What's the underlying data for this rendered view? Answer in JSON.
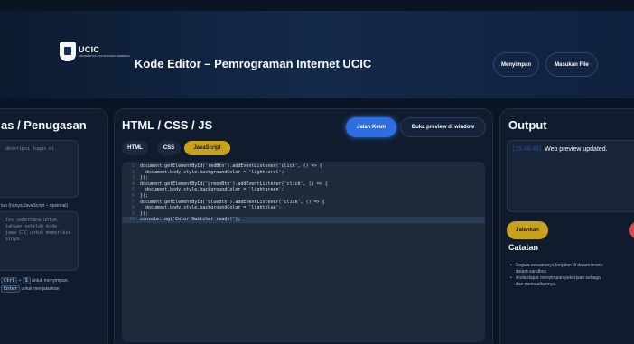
{
  "header": {
    "logo_main": "UCIC",
    "logo_sub": "UNIVERSITAS CATUR INSAN CENDEKIA",
    "title": "Kode Editor – Pemrograman Internet UCIC",
    "save_label": "Menyimpan",
    "load_label": "Masukan File"
  },
  "left_panel": {
    "title": "as / Penugasan",
    "desc_placeholder": "deskripsi tugas di",
    "js_label": "tuo (hanya JavaScript – opsional)",
    "js_text": "Tes sederhana untuk\ntahkan setelah kode\njawa CIC untuk memeriksa\nsinya.",
    "hint_key1": "Ctrl",
    "hint_plus": "+",
    "hint_key2": "S",
    "hint_text1": "untuk menyimpan,",
    "hint_key3": "Enter",
    "hint_text2": "untuk menjalankan"
  },
  "editor": {
    "title": "HTML / CSS / JS",
    "run_label": "Jalan Keun",
    "preview_label": "Buka preview di window",
    "tabs": [
      "HTML",
      "CSS",
      "JavaScript"
    ],
    "active_tab": "JavaScript",
    "lines": [
      {
        "n": "1",
        "code": "document.getElementById('redBtn').addEventListener('click', () => {"
      },
      {
        "n": "2",
        "code": "  document.body.style.backgroundColor = 'lightcoral';"
      },
      {
        "n": "3",
        "code": "});"
      },
      {
        "n": "4",
        "code": "document.getElementById('greenBtn').addEventListener('click', () => {"
      },
      {
        "n": "5",
        "code": "  document.body.style.backgroundColor = 'lightgreen';"
      },
      {
        "n": "6",
        "code": "});"
      },
      {
        "n": "7",
        "code": "document.getElementById('blueBtn').addEventListener('click', () => {"
      },
      {
        "n": "8",
        "code": "  document.body.style.backgroundColor = 'lightblue';"
      },
      {
        "n": "9",
        "code": "});"
      },
      {
        "n": "10",
        "code": "console.log('Color Switcher ready!');"
      }
    ]
  },
  "output": {
    "title": "Output",
    "timestamp": "[15:48:49]",
    "message": "Web preview updated.",
    "run_label": "Jalankan",
    "notes_title": "Catatan",
    "notes": [
      "Segala sesuatunya berjalan di dalam brows\ndalam sandbox.",
      "Anda dapat menyimpan pekerjaan sebaga\ndan memuatkannya."
    ]
  },
  "colors": {
    "accent_blue": "#2e6fe0",
    "accent_yellow": "#c9a21d",
    "danger_red": "#e04646",
    "background": "#0b1422"
  }
}
